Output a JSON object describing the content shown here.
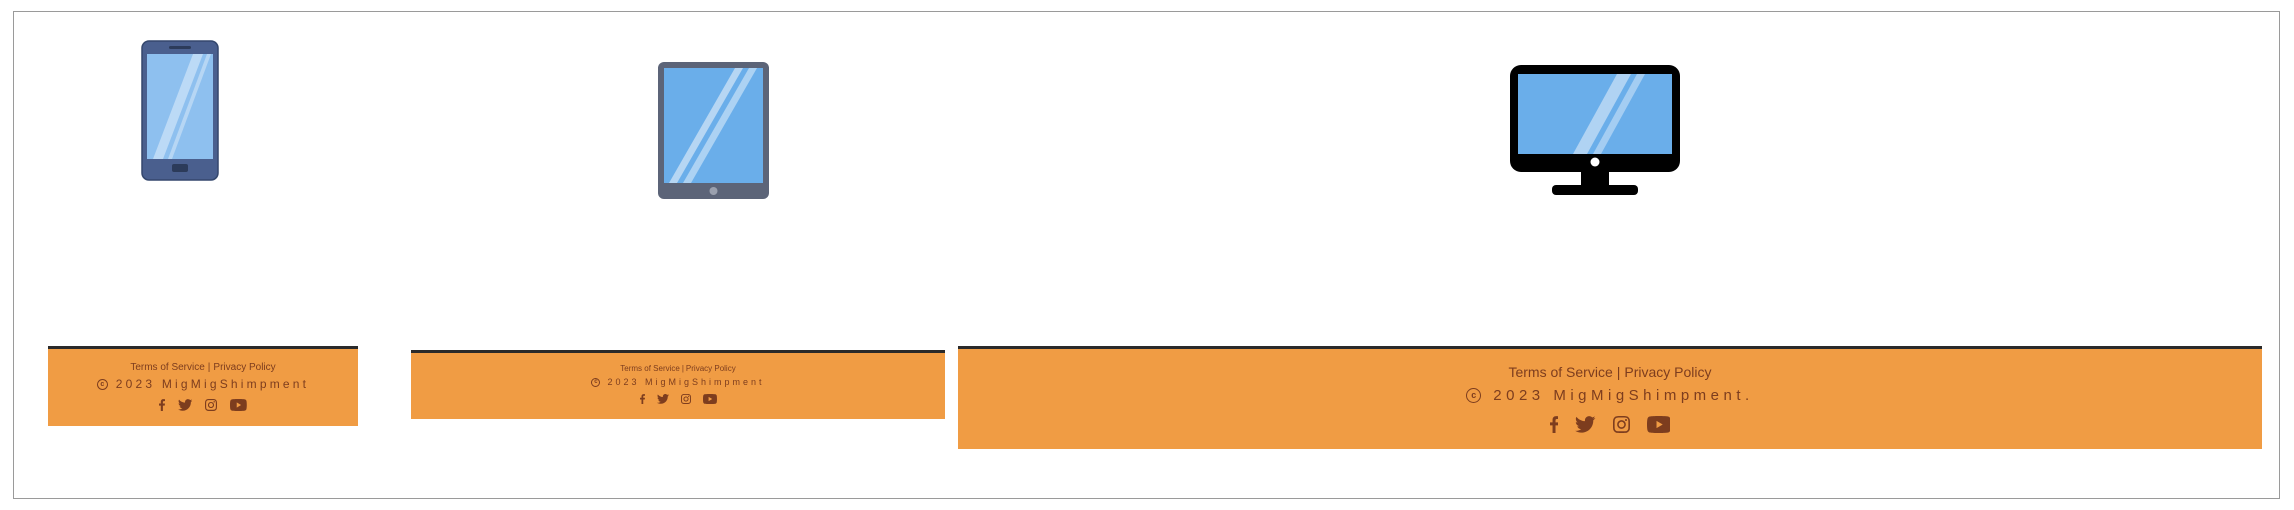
{
  "theme": {
    "footer_bg": "#f09c44",
    "footer_text": "#7d3d1e",
    "border": "#2a2a2a"
  },
  "devices": [
    {
      "name": "phone",
      "icon": "smartphone-icon"
    },
    {
      "name": "tablet",
      "icon": "tablet-icon"
    },
    {
      "name": "desktop",
      "icon": "desktop-monitor-icon"
    }
  ],
  "footers": {
    "phone": {
      "terms": "Terms of Service",
      "separator": "|",
      "privacy": "Privacy Policy",
      "copyright": "2023 MigMigShimpment"
    },
    "tablet": {
      "terms": "Terms of Service",
      "separator": "|",
      "privacy": "Privacy Policy",
      "copyright": "2023 MigMigShimpment"
    },
    "desktop": {
      "terms": "Terms of Service",
      "separator": "|",
      "privacy": "Privacy Policy",
      "copyright": "2023 MigMigShimpment."
    }
  },
  "social_icons": [
    "facebook-icon",
    "twitter-icon",
    "instagram-icon",
    "youtube-icon"
  ]
}
